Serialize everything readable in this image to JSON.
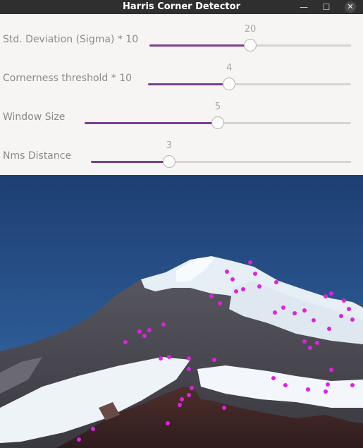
{
  "window": {
    "title": "Harris Corner Detector",
    "minimize_icon": "minimize-icon",
    "maximize_icon": "maximize-icon",
    "close_icon": "close-icon"
  },
  "sliders": [
    {
      "label": "Std. Deviation (Sigma) * 10",
      "value": "20",
      "fraction": 0.5
    },
    {
      "label": "Cornerness threshold * 10",
      "value": "4",
      "fraction": 0.4
    },
    {
      "label": "Window Size",
      "value": "5",
      "fraction": 0.5
    },
    {
      "label": "Nms Distance",
      "value": "3",
      "fraction": 0.3
    }
  ],
  "colors": {
    "accent": "#7b3f8e",
    "corner_marker": "#e020e0",
    "titlebar": "#2f2f2f"
  }
}
